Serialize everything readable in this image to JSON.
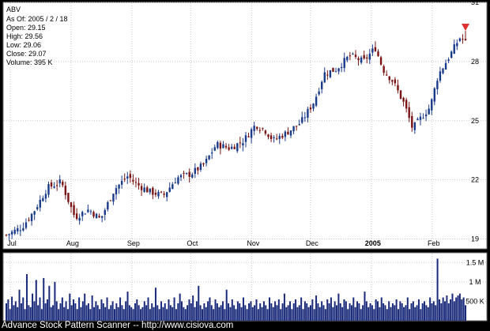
{
  "footer": {
    "text": "Advance Stock Pattern Scanner -- http://www.cisiova.com"
  },
  "info": {
    "symbol": "ABV",
    "lines": [
      "As Of: 2005 / 2 / 18",
      "Open: 29.15",
      "High: 29.56",
      "Low: 29.06",
      "Close: 29.07",
      "Volume: 395 K"
    ]
  },
  "colors": {
    "background": "#000000",
    "panel": "#ffffff",
    "panel_border": "#777777",
    "up_candle": "#1a3a8a",
    "down_candle": "#7a1414",
    "volume_bar": "#1a2a7a",
    "grid": "#c8c8c8",
    "text": "#000000",
    "marker": "#e03030"
  },
  "chart_data": [
    {
      "type": "candlestick",
      "title": "ABV",
      "x_tick_labels": [
        "Jul",
        "Aug",
        "Sep",
        "Oct",
        "Nov",
        "Dec",
        "2005",
        "Feb"
      ],
      "y_tick_labels": [
        "19",
        "22",
        "25",
        "28",
        "31"
      ],
      "ylim": [
        18.5,
        31
      ],
      "grid": true,
      "close_anchors": [
        {
          "x": "Jun 29",
          "y": 19.2
        },
        {
          "x": "Jul 7",
          "y": 19.6
        },
        {
          "x": "Jul 13",
          "y": 20.4
        },
        {
          "x": "Jul 20",
          "y": 21.6
        },
        {
          "x": "Jul 27",
          "y": 21.9
        },
        {
          "x": "Jul 30",
          "y": 21.1
        },
        {
          "x": "Aug 3",
          "y": 20.1
        },
        {
          "x": "Aug 10",
          "y": 20.5
        },
        {
          "x": "Aug 16",
          "y": 20.0
        },
        {
          "x": "Aug 23",
          "y": 21.5
        },
        {
          "x": "Aug 30",
          "y": 22.2
        },
        {
          "x": "Sep 3",
          "y": 21.8
        },
        {
          "x": "Sep 10",
          "y": 21.4
        },
        {
          "x": "Sep 17",
          "y": 21.2
        },
        {
          "x": "Sep 24",
          "y": 22.1
        },
        {
          "x": "Oct 1",
          "y": 22.3
        },
        {
          "x": "Oct 8",
          "y": 22.8
        },
        {
          "x": "Oct 14",
          "y": 23.8
        },
        {
          "x": "Oct 21",
          "y": 23.6
        },
        {
          "x": "Oct 28",
          "y": 24.0
        },
        {
          "x": "Nov 3",
          "y": 24.8
        },
        {
          "x": "Nov 8",
          "y": 24.5
        },
        {
          "x": "Nov 12",
          "y": 24.0
        },
        {
          "x": "Nov 19",
          "y": 24.4
        },
        {
          "x": "Nov 26",
          "y": 24.9
        },
        {
          "x": "Dec 3",
          "y": 26.0
        },
        {
          "x": "Dec 8",
          "y": 27.4
        },
        {
          "x": "Dec 14",
          "y": 27.6
        },
        {
          "x": "Dec 21",
          "y": 28.3
        },
        {
          "x": "Dec 28",
          "y": 28.0
        },
        {
          "x": "Jan 3",
          "y": 28.7
        },
        {
          "x": "Jan 7",
          "y": 27.6
        },
        {
          "x": "Jan 12",
          "y": 27.0
        },
        {
          "x": "Jan 18",
          "y": 25.8
        },
        {
          "x": "Jan 22",
          "y": 24.6
        },
        {
          "x": "Jan 26",
          "y": 25.1
        },
        {
          "x": "Jan 31",
          "y": 25.7
        },
        {
          "x": "Feb 4",
          "y": 27.3
        },
        {
          "x": "Feb 10",
          "y": 28.3
        },
        {
          "x": "Feb 15",
          "y": 29.2
        },
        {
          "x": "Feb 18",
          "y": 29.07
        }
      ],
      "last_candle": {
        "x": "Feb 18",
        "open": 29.15,
        "high": 29.56,
        "low": 29.06,
        "close": 29.07
      }
    },
    {
      "type": "bar",
      "title": "Volume",
      "y_tick_labels": [
        "500 K",
        "1 M",
        "1.5 M"
      ],
      "ylim": [
        0,
        1.75
      ],
      "y_unit": "M",
      "grid": true,
      "values": [
        0.45,
        0.55,
        0.3,
        0.62,
        0.4,
        0.5,
        0.35,
        0.8,
        0.45,
        0.6,
        0.3,
        1.2,
        0.4,
        0.35,
        0.7,
        0.5,
        1.05,
        0.4,
        0.6,
        0.3,
        1.1,
        0.45,
        0.55,
        0.9,
        0.35,
        0.4,
        1.0,
        0.5,
        0.3,
        0.45,
        0.6,
        0.35,
        0.5,
        0.3,
        0.7,
        0.4,
        0.55,
        0.45,
        0.3,
        0.6,
        0.35,
        0.5,
        0.7,
        0.4,
        0.45,
        0.3,
        0.65,
        0.35,
        0.5,
        0.4,
        0.3,
        0.55,
        0.45,
        0.35,
        0.6,
        0.3,
        0.4,
        0.5,
        0.3,
        0.45,
        0.35,
        0.6,
        0.4,
        0.3,
        0.5,
        0.75,
        0.4,
        0.35,
        0.3,
        0.45,
        0.55,
        0.4,
        0.3,
        0.35,
        0.5,
        0.4,
        0.6,
        0.3,
        0.45,
        0.35,
        0.85,
        0.4,
        0.3,
        0.5,
        0.35,
        0.45,
        0.3,
        0.55,
        0.4,
        0.35,
        0.6,
        0.3,
        0.45,
        0.7,
        0.5,
        0.35,
        0.3,
        0.4,
        0.55,
        0.45,
        0.65,
        0.35,
        0.5,
        0.9,
        0.4,
        0.3,
        0.45,
        0.35,
        0.5,
        0.6,
        0.4,
        0.3,
        0.55,
        0.45,
        0.35,
        0.4,
        0.5,
        0.3,
        0.8,
        0.45,
        0.35,
        0.55,
        0.4,
        0.3,
        0.5,
        0.45,
        0.35,
        0.6,
        0.4,
        0.3,
        0.45,
        0.5,
        0.35,
        0.4,
        0.55,
        0.3,
        0.45,
        0.35,
        0.5,
        0.4,
        0.3,
        0.6,
        0.45,
        0.35,
        0.5,
        0.4,
        0.55,
        0.3,
        0.45,
        0.7,
        0.35,
        0.4,
        0.5,
        0.3,
        0.45,
        0.55,
        0.35,
        0.4,
        0.6,
        0.3,
        0.5,
        0.45,
        0.35,
        0.4,
        0.55,
        0.3,
        0.65,
        0.45,
        0.35,
        0.5,
        0.4,
        0.3,
        0.55,
        0.45,
        0.6,
        0.35,
        0.5,
        0.4,
        0.7,
        0.45,
        0.35,
        0.55,
        0.5,
        0.3,
        0.45,
        0.4,
        0.6,
        0.35,
        0.5,
        0.45,
        0.3,
        0.4,
        0.75,
        0.5,
        0.35,
        0.45,
        0.4,
        0.3,
        0.55,
        0.5,
        0.35,
        0.6,
        0.45,
        0.4,
        0.3,
        0.5,
        0.35,
        0.45,
        0.4,
        0.55,
        0.3,
        0.5,
        0.45,
        0.35,
        0.4,
        0.6,
        0.3,
        0.45,
        0.5,
        0.35,
        0.4,
        0.55,
        0.3,
        0.45,
        0.5,
        0.4,
        0.35,
        0.6,
        0.45,
        0.5,
        0.4,
        1.6,
        0.55,
        0.45,
        0.6,
        0.5,
        0.65,
        0.45,
        0.55,
        0.7,
        0.5,
        0.6,
        0.65,
        0.7,
        0.55,
        0.6,
        0.4
      ]
    }
  ]
}
